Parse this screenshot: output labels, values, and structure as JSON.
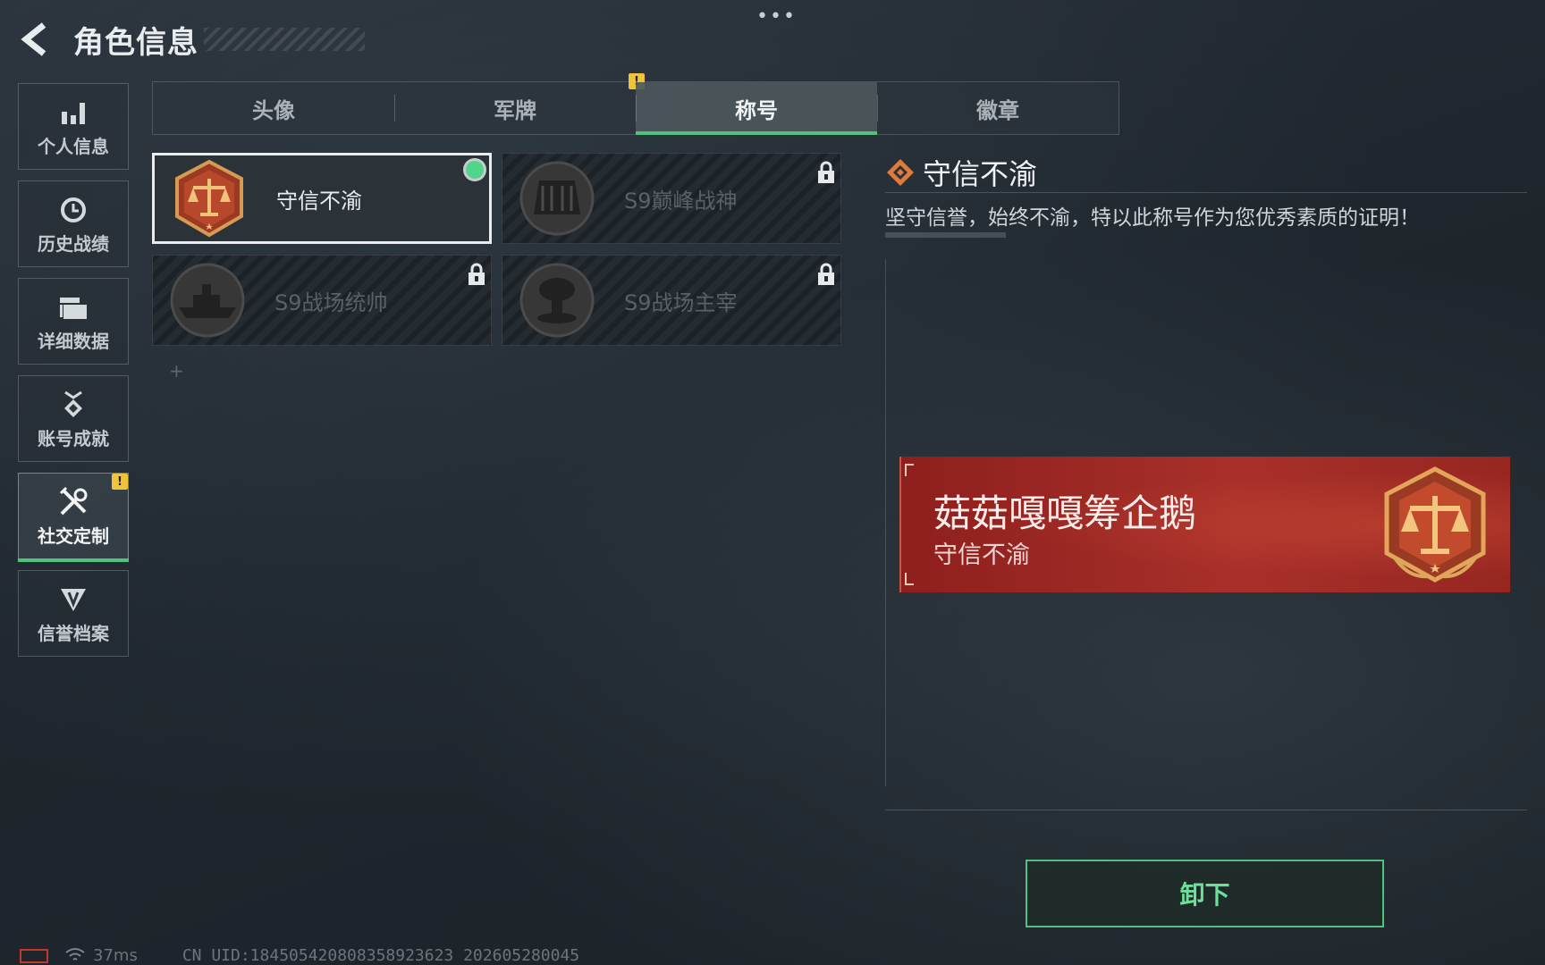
{
  "window": {
    "more_dots": "•••"
  },
  "header": {
    "title": "角色信息"
  },
  "sidebar": {
    "items": [
      {
        "label": "个人信息",
        "icon": "bar-chart-icon",
        "active": false
      },
      {
        "label": "历史战绩",
        "icon": "history-clock-icon",
        "active": false
      },
      {
        "label": "详细数据",
        "icon": "folder-icon",
        "active": false
      },
      {
        "label": "账号成就",
        "icon": "medal-icon",
        "active": false
      },
      {
        "label": "社交定制",
        "icon": "tools-icon",
        "active": true,
        "badge": "!"
      },
      {
        "label": "信誉档案",
        "icon": "shield-wing-icon",
        "active": false
      }
    ]
  },
  "tabs": [
    {
      "label": "头像"
    },
    {
      "label": "军牌",
      "badge": "!"
    },
    {
      "label": "称号",
      "active": true
    },
    {
      "label": "徽章"
    }
  ],
  "titles": [
    {
      "name": "守信不渝",
      "selected": true,
      "equipped": true,
      "locked": false,
      "icon": "scales-emblem-icon"
    },
    {
      "name": "S9巅峰战神",
      "locked": true,
      "icon": "fortress-emblem-icon"
    },
    {
      "name": "S9战场统帅",
      "locked": true,
      "icon": "warship-emblem-icon"
    },
    {
      "name": "S9战场主宰",
      "locked": true,
      "icon": "mushroom-cloud-emblem-icon"
    }
  ],
  "detail": {
    "title": "守信不渝",
    "description": "坚守信誉，始终不渝，特以此称号作为您优秀素质的证明！"
  },
  "banner": {
    "player_name": "菇菇嘎嘎筹企鹅",
    "title": "守信不渝"
  },
  "actions": {
    "unequip_label": "卸下"
  },
  "footer": {
    "ping": "37ms",
    "uid": "CN UID:184505420808358923623 202605280045"
  },
  "colors": {
    "accent_green": "#4fc27d",
    "badge_yellow": "#f0c43a",
    "banner_red": "#a8302a"
  }
}
